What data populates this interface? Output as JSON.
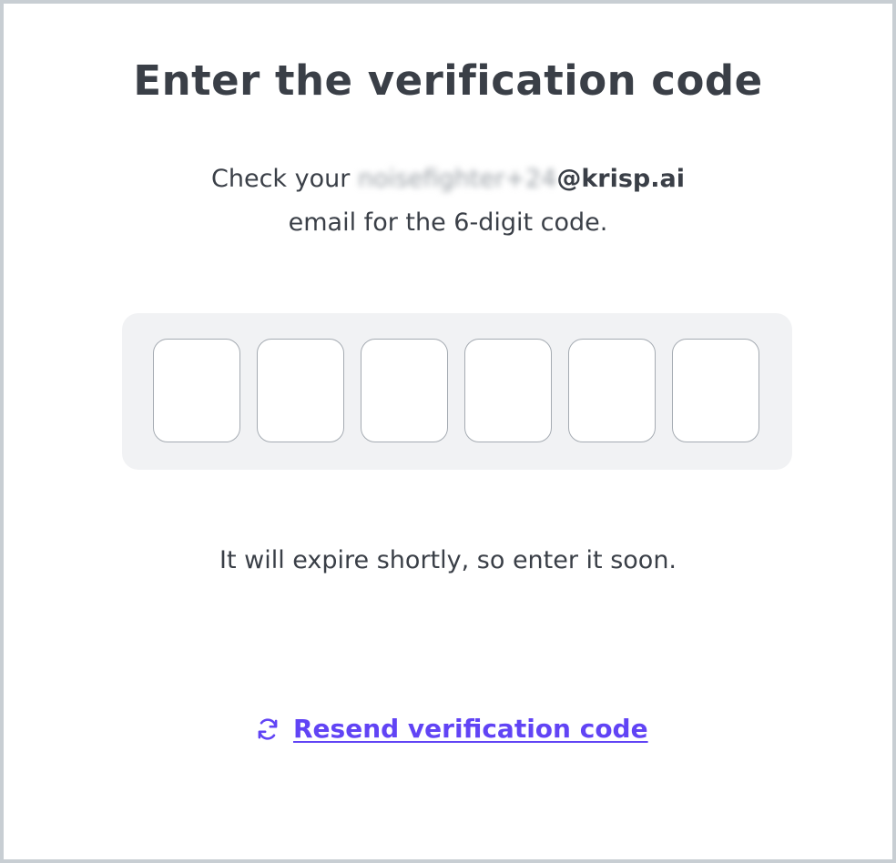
{
  "page": {
    "title": "Enter the verification code"
  },
  "instructions": {
    "prefix": "Check your ",
    "email_local": "noisefighter+24",
    "email_domain": "@krisp.ai",
    "line2": "email for the 6-digit code."
  },
  "code_inputs": {
    "count": 6,
    "values": [
      "",
      "",
      "",
      "",
      "",
      ""
    ]
  },
  "expire_note": "It will expire shortly, so enter it soon.",
  "resend": {
    "label": "Resend verification code",
    "icon": "refresh-icon"
  },
  "colors": {
    "text": "#3a3f47",
    "accent": "#6144f5",
    "panel_bg": "#f1f2f4",
    "box_border": "#a5abb2",
    "frame_border": "#c8ced3"
  }
}
